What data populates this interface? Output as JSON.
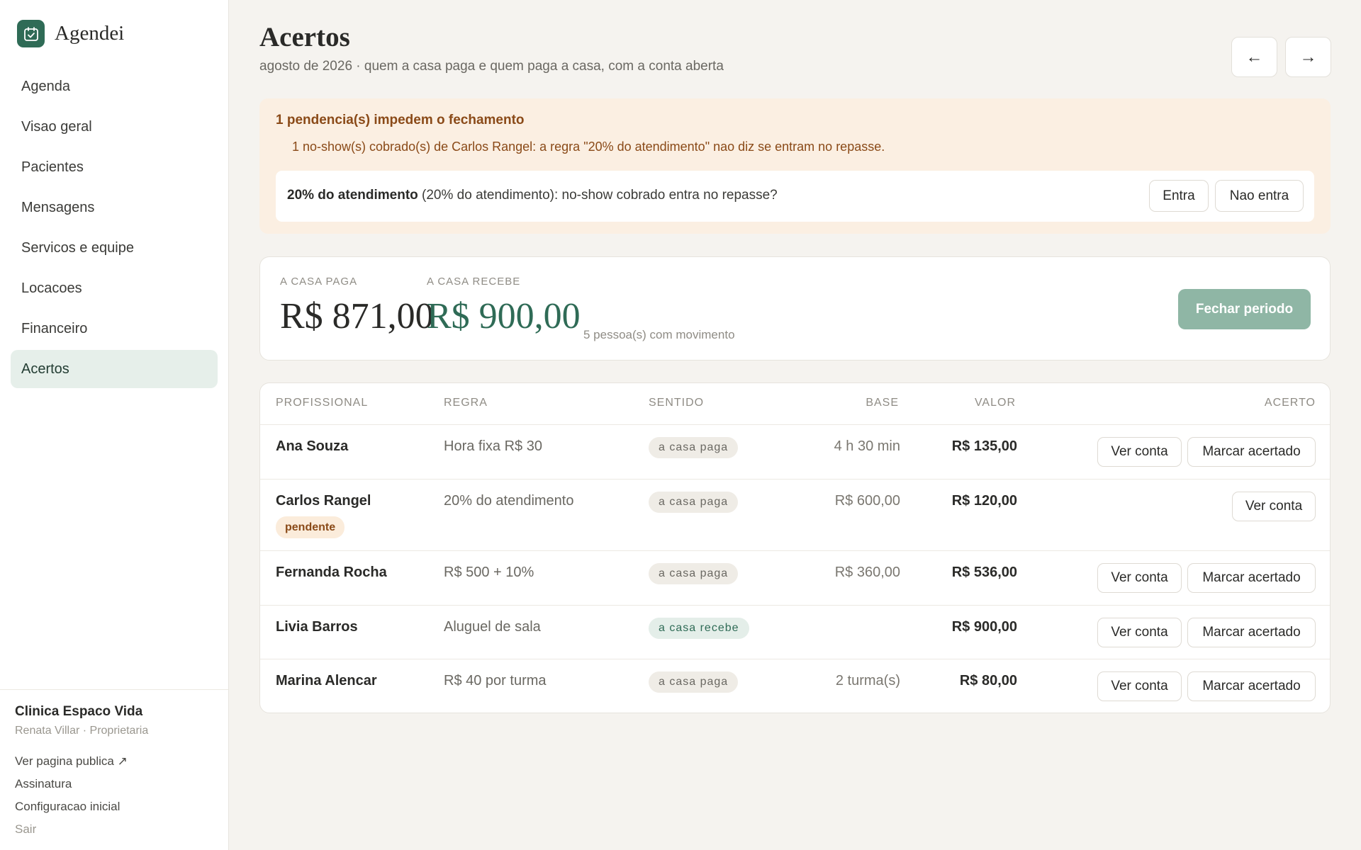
{
  "brand": {
    "name": "Agendei",
    "logo_icon": "calendar-check-icon"
  },
  "sidebar": {
    "items": [
      {
        "label": "Agenda"
      },
      {
        "label": "Visao geral"
      },
      {
        "label": "Pacientes"
      },
      {
        "label": "Mensagens"
      },
      {
        "label": "Servicos e equipe"
      },
      {
        "label": "Locacoes"
      },
      {
        "label": "Financeiro"
      },
      {
        "label": "Acertos",
        "active": true
      }
    ],
    "footer": {
      "clinic": "Clinica Espaco Vida",
      "user": "Renata Villar · Proprietaria",
      "links": [
        "Ver pagina publica ↗",
        "Assinatura",
        "Configuracao inicial",
        "Sair"
      ]
    }
  },
  "header": {
    "title": "Acertos",
    "subtitle": "agosto de 2026 · quem a casa paga e quem paga a casa, com a conta aberta",
    "prev": "←",
    "next": "→"
  },
  "alert": {
    "title": "1 pendencia(s) impedem o fechamento",
    "message": "1 no-show(s) cobrado(s) de Carlos Rangel: a regra \"20% do atendimento\" nao diz se entram no repasse.",
    "question_rule": "20% do atendimento",
    "question_text": " (20% do atendimento): no-show cobrado entra no repasse?",
    "yes_label": "Entra",
    "no_label": "Nao entra"
  },
  "summary": {
    "pays_label": "A CASA PAGA",
    "pays_value": "R$ 871,00",
    "receives_label": "A CASA RECEBE",
    "receives_value": "R$ 900,00",
    "people": "5 pessoa(s) com movimento",
    "close_label": "Fechar periodo"
  },
  "table": {
    "headers": [
      "PROFISSIONAL",
      "REGRA",
      "SENTIDO",
      "BASE",
      "VALOR",
      "ACERTO"
    ],
    "rows": [
      {
        "name": "Ana Souza",
        "rule": "Hora fixa R$ 30",
        "direction": "a casa paga",
        "base": "4 h 30 min",
        "value": "R$ 135,00",
        "view": "Ver conta",
        "mark": "Marcar acertado"
      },
      {
        "name": "Carlos Rangel",
        "badge": "pendente",
        "rule": "20% do atendimento",
        "direction": "a casa paga",
        "base": "R$ 600,00",
        "value": "R$ 120,00",
        "view": "Ver conta"
      },
      {
        "name": "Fernanda Rocha",
        "rule": "R$ 500 + 10%",
        "direction": "a casa paga",
        "base": "R$ 360,00",
        "value": "R$ 536,00",
        "view": "Ver conta",
        "mark": "Marcar acertado"
      },
      {
        "name": "Livia Barros",
        "rule": "Aluguel de sala",
        "direction": "a casa recebe",
        "base": "",
        "value": "R$ 900,00",
        "view": "Ver conta",
        "mark": "Marcar acertado"
      },
      {
        "name": "Marina Alencar",
        "rule": "R$ 40 por turma",
        "direction": "a casa paga",
        "base": "2 turma(s)",
        "value": "R$ 80,00",
        "view": "Ver conta",
        "mark": "Marcar acertado"
      }
    ]
  },
  "colors": {
    "accent": "#2f6b56",
    "pending": "#8a4a18",
    "alert_bg": "#fbefe2"
  }
}
